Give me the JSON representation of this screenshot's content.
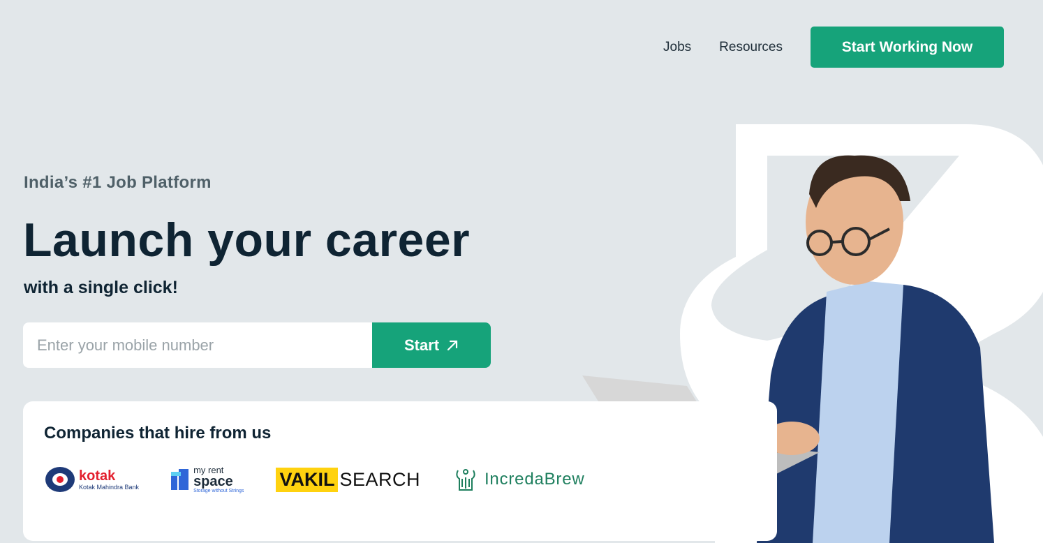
{
  "nav": {
    "links": [
      "Jobs",
      "Resources"
    ],
    "cta_label": "Start Working Now"
  },
  "hero": {
    "tagline": "India’s #1 Job Platform",
    "headline": "Launch your career",
    "subheadline": "with a single click!",
    "input_placeholder": "Enter your mobile number",
    "start_label": "Start"
  },
  "companies": {
    "title": "Companies that hire from us",
    "kotak": {
      "name": "kotak",
      "sub": "Kotak Mahindra Bank"
    },
    "myrent": {
      "top": "my rent",
      "main": "space",
      "tag": "Storage without Strings"
    },
    "vakil": {
      "part1": "VAKIL",
      "part2": "SEARCH"
    },
    "increda": {
      "name": "IncredaBrew"
    }
  },
  "colors": {
    "background": "#e2e7ea",
    "accent": "#16a37a",
    "heading": "#0f2433"
  },
  "icons": {
    "start_arrow": "arrow-up-right-icon"
  }
}
